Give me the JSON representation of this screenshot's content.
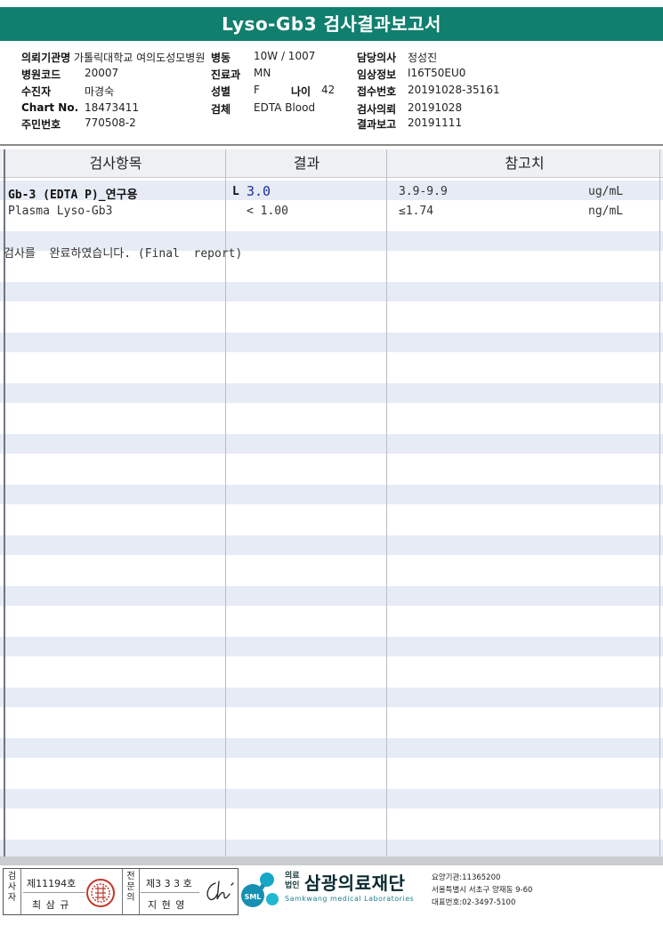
{
  "report": {
    "title": "Lyso-Gb3 검사결과보고서"
  },
  "patient": {
    "institution_label": "의뢰기관명",
    "institution_value": "가톨릭대학교 여의도성모병원",
    "ward_label": "병동",
    "ward_value": "10W / 1007",
    "doctor_label": "담당의사",
    "doctor_value": "정성진",
    "hospital_code_label": "병원코드",
    "hospital_code_value": "20007",
    "department_label": "진료과",
    "department_value": "MN",
    "clinical_info_label": "임상정보",
    "clinical_info_value": "I16T50EU0",
    "recipient_label": "수진자",
    "recipient_value": "마경숙",
    "sex_label": "성별",
    "sex_value": "F",
    "age_label": "나이",
    "age_value": "42",
    "receipt_no_label": "접수번호",
    "receipt_no_value": "20191028-35161",
    "chart_no_label": "Chart No.",
    "chart_no_value": "18473411",
    "specimen_label": "검체",
    "specimen_value": "EDTA Blood",
    "request_date_label": "검사의뢰",
    "request_date_value": "20191028",
    "resident_no_label": "주민번호",
    "resident_no_value": "770508-2",
    "result_date_label": "결과보고",
    "result_date_value": "20191111"
  },
  "table": {
    "headers": [
      "검사항목",
      "결과",
      "참고치"
    ],
    "rows": [
      {
        "item": "Gb-3 (EDTA P)_연구용",
        "flag": "L",
        "result": "3.0",
        "reference": "3.9-9.9",
        "unit": "ug/mL"
      },
      {
        "item": "Plasma Lyso-Gb3",
        "flag": "",
        "result": "< 1.00",
        "reference": "≤1.74",
        "unit": "ng/mL"
      }
    ],
    "note": "검사를  완료하였습니다. (Final  report)"
  },
  "footer": {
    "tester_label": "검사자",
    "tester_no": "제11194호",
    "tester_name": "최 삼 규",
    "specialist_label": "전문의",
    "specialist_no": "제3 3 3 호",
    "specialist_name": "지 현 영",
    "org_prefix_top": "의료",
    "org_prefix_bottom": "법인",
    "org_name": "삼광의료재단",
    "org_eng": "Samkwang medical Laboratories",
    "logo_text": "SML",
    "org_code": "요양기관:11365200",
    "org_address": "서울특별시 서초구 양재동 9-60",
    "org_phone": "대표번호:02-3497-5100"
  }
}
